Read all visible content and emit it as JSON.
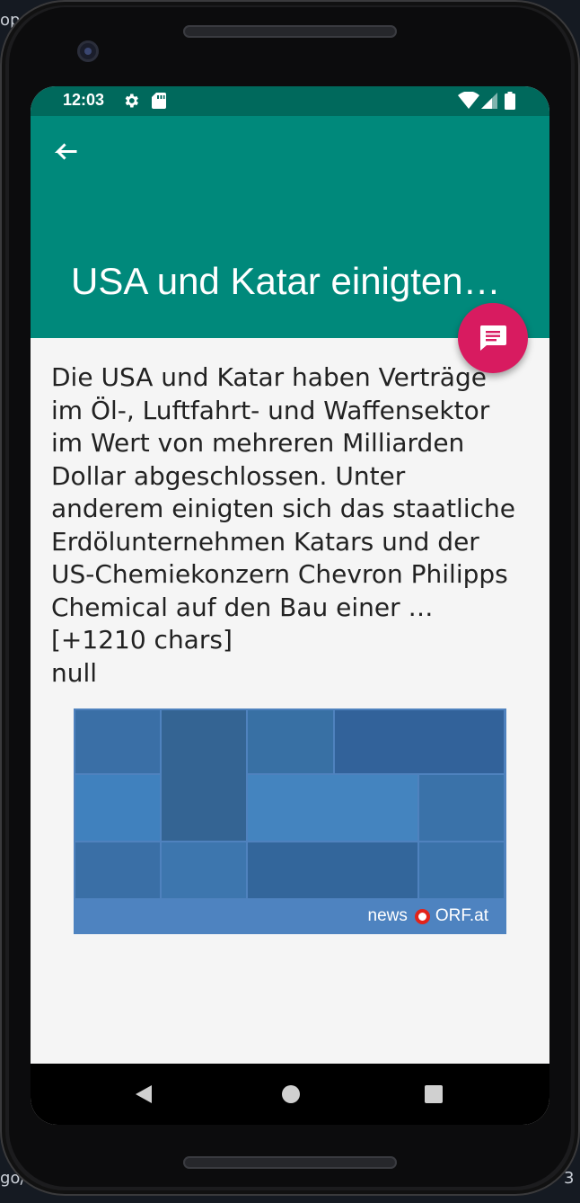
{
  "background": {
    "left_text": "op",
    "left_text2": "go/",
    "right_text": "3"
  },
  "status_bar": {
    "time": "12:03",
    "icons": [
      "gear-icon",
      "sd-card-icon",
      "wifi-icon",
      "signal-icon",
      "battery-icon"
    ]
  },
  "app_bar": {
    "title": "USA und Katar einigten sich auf Milliardendeals",
    "back_icon": "arrow-back-icon",
    "color": "#00897b",
    "status_color": "#00695c"
  },
  "fab": {
    "icon": "message-icon",
    "color": "#d81b60"
  },
  "article": {
    "body": "Die USA und Katar haben Verträge im Öl-, Luftfahrt- und Waffensektor im Wert von mehreren Milliarden Dollar abgeschlossen. Unter anderem einigten sich das staatliche Erdölunternehmen Katars und der US-Chemiekonzern Chevron Philipps Chemical auf den Bau einer … [+1210 chars]",
    "extra": "null"
  },
  "image": {
    "brand_prefix": "news",
    "brand_suffix": "ORF.at"
  },
  "nav": {
    "back": "triangle-back-icon",
    "home": "circle-home-icon",
    "recents": "square-recents-icon"
  }
}
